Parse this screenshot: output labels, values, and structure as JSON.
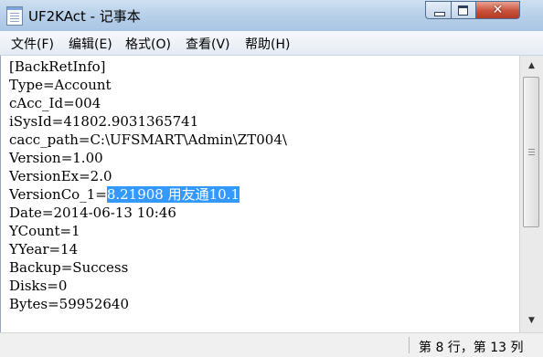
{
  "window": {
    "title": "UF2KAct - 记事本",
    "icon": "notepad-icon",
    "controls": {
      "minimize": "minimize-icon",
      "maximize": "maximize-icon",
      "close_glyph": "✕"
    }
  },
  "menu": {
    "file": "文件(F)",
    "edit": "编辑(E)",
    "format": "格式(O)",
    "view": "查看(V)",
    "help": "帮助(H)"
  },
  "content": {
    "lines": [
      "[BackRetInfo]",
      "Type=Account",
      "cAcc_Id=004",
      "iSysId=41802.9031365741",
      "cacc_path=C:\\UFSMART\\Admin\\ZT004\\",
      "Version=1.00",
      "VersionEx=2.0",
      "VersionCo_1=8.21908 用友通10.1",
      "Date=2014-06-13 10:46",
      "YCount=1",
      "YYear=14",
      "Backup=Success",
      "Disks=0",
      "Bytes=59952640"
    ],
    "selected_line": {
      "prefix": "VersionCo_1=",
      "selected_text": "8.21908 用友通10.1"
    }
  },
  "status": {
    "position": "第 8 行，第 13 列"
  },
  "colors": {
    "selection": "#3399ff",
    "titlebar": "#b9d1ea",
    "close_button": "#c8513b"
  }
}
